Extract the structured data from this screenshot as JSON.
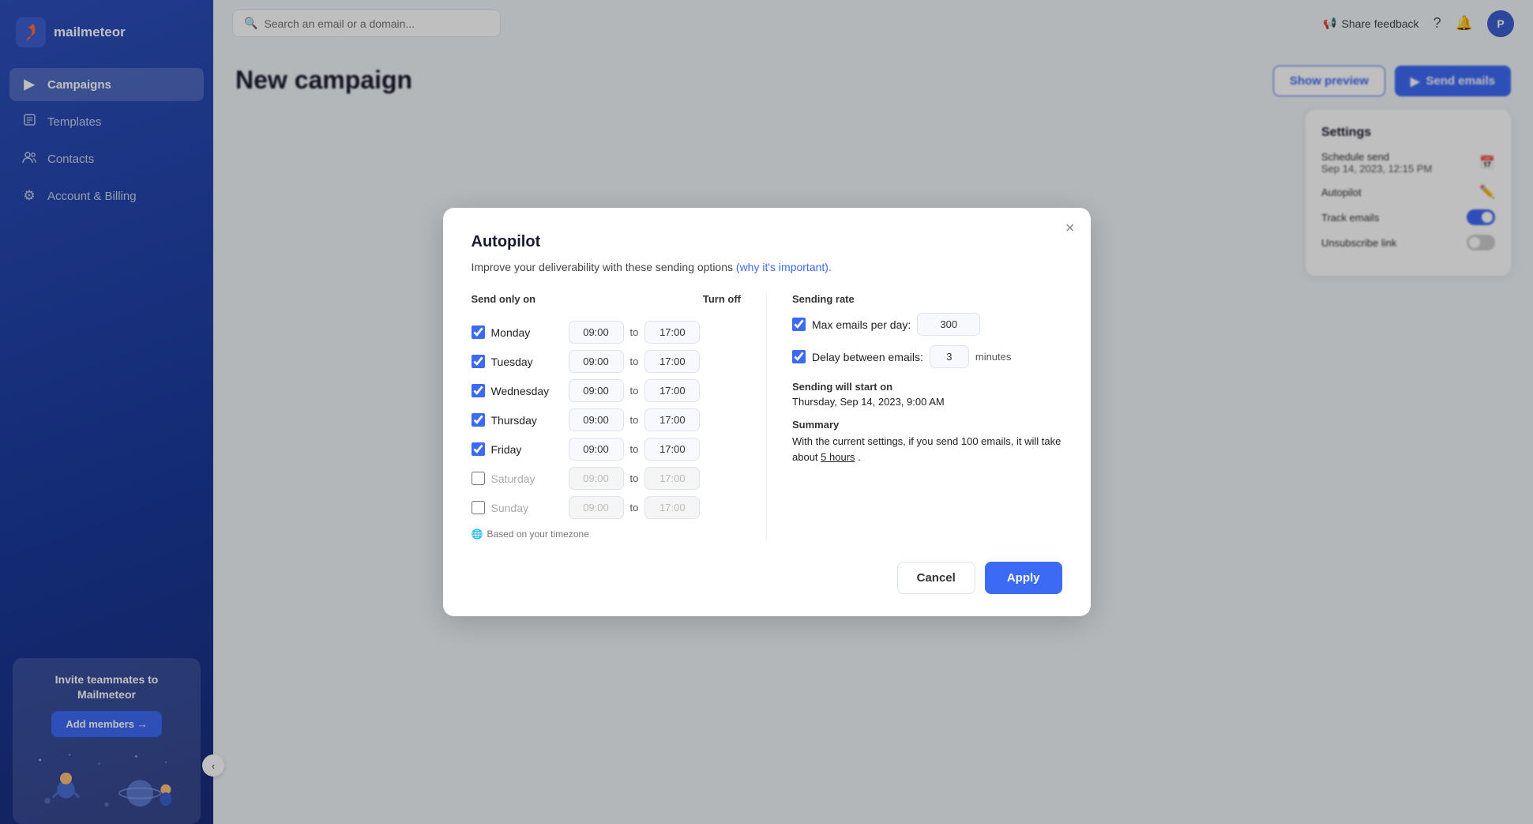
{
  "sidebar": {
    "logo_text": "mailmeteor",
    "logo_icon": "M",
    "items": [
      {
        "id": "campaigns",
        "label": "Campaigns",
        "icon": "▶",
        "active": true
      },
      {
        "id": "templates",
        "label": "Templates",
        "icon": "📄",
        "active": false
      },
      {
        "id": "contacts",
        "label": "Contacts",
        "icon": "👥",
        "active": false
      },
      {
        "id": "account-billing",
        "label": "Account & Billing",
        "icon": "⚙",
        "active": false
      }
    ],
    "invite": {
      "title": "Invite teammates to Mailmeteor",
      "button_label": "Add members →"
    }
  },
  "topbar": {
    "search_placeholder": "Search an email or a domain...",
    "share_feedback": "Share feedback"
  },
  "page": {
    "title": "New campaign",
    "show_preview_label": "Show preview",
    "send_emails_label": "Send emails"
  },
  "settings_panel": {
    "title": "Settings",
    "schedule_send_label": "Schedule send",
    "schedule_send_value": "Sep 14, 2023, 12:15 PM",
    "autopilot_label": "Autopilot",
    "track_emails_label": "Track emails",
    "unsubscribe_link_label": "Unsubscribe link"
  },
  "modal": {
    "title": "Autopilot",
    "subtitle": "Improve your deliverability with these sending options",
    "subtitle_link": "(why it's important).",
    "close_label": "×",
    "send_only_on_label": "Send only on",
    "turn_off_label": "Turn off",
    "days": [
      {
        "id": "monday",
        "label": "Monday",
        "checked": true,
        "from": "09:00",
        "to": "17:00",
        "disabled": false
      },
      {
        "id": "tuesday",
        "label": "Tuesday",
        "checked": true,
        "from": "09:00",
        "to": "17:00",
        "disabled": false
      },
      {
        "id": "wednesday",
        "label": "Wednesday",
        "checked": true,
        "from": "09:00",
        "to": "17:00",
        "disabled": false
      },
      {
        "id": "thursday",
        "label": "Thursday",
        "checked": true,
        "from": "09:00",
        "to": "17:00",
        "disabled": false
      },
      {
        "id": "friday",
        "label": "Friday",
        "checked": true,
        "from": "09:00",
        "to": "17:00",
        "disabled": false
      },
      {
        "id": "saturday",
        "label": "Saturday",
        "checked": false,
        "from": "09:00",
        "to": "17:00",
        "disabled": true
      },
      {
        "id": "sunday",
        "label": "Sunday",
        "checked": false,
        "from": "09:00",
        "to": "17:00",
        "disabled": true
      }
    ],
    "timezone_note": "Based on your timezone",
    "sending_rate_label": "Sending rate",
    "max_emails_label": "Max emails per day:",
    "max_emails_value": "300",
    "max_emails_checked": true,
    "delay_label": "Delay between emails:",
    "delay_value": "3",
    "delay_unit": "minutes",
    "delay_checked": true,
    "sending_start_label": "Sending will start on",
    "sending_start_value": "Thursday, Sep 14, 2023, 9:00 AM",
    "summary_label": "Summary",
    "summary_text": "With the current settings, if you send 100 emails, it will take about",
    "summary_highlight": "5 hours",
    "summary_end": ".",
    "cancel_label": "Cancel",
    "apply_label": "Apply"
  }
}
